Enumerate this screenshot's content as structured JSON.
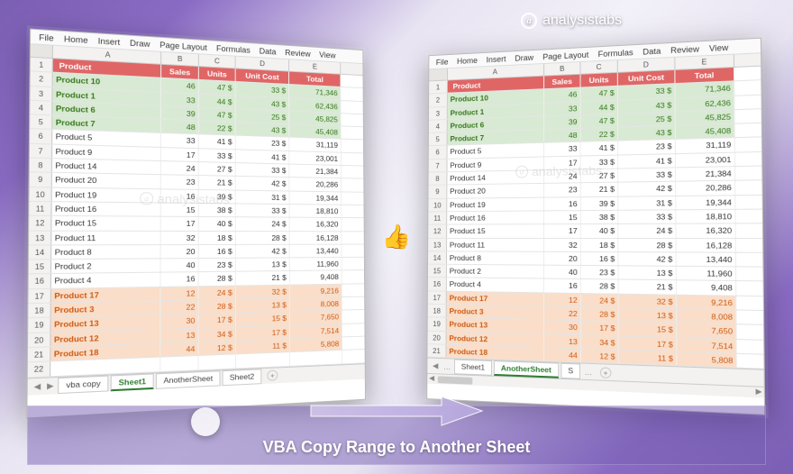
{
  "brand": "analysistabs",
  "banner_title": "VBA Copy Range to Another Sheet",
  "ribbon": [
    "File",
    "Home",
    "Insert",
    "Draw",
    "Page Layout",
    "Formulas",
    "Data",
    "Review",
    "View"
  ],
  "columns": [
    "A",
    "B",
    "C",
    "D",
    "E"
  ],
  "header_row": {
    "product": "Product",
    "sales": "Sales",
    "units": "Units",
    "unit_cost": "Unit Cost",
    "total": "Total"
  },
  "left_rows": [
    {
      "n": 1,
      "cls": "hdr-row",
      "a": "Product",
      "b": "Sales",
      "c": "Units",
      "d": "Unit Cost",
      "e": "Total"
    },
    {
      "n": 2,
      "cls": "green",
      "a": "Product 10",
      "b": "46",
      "c": "47 $",
      "d": "33 $",
      "e": "71,346"
    },
    {
      "n": 3,
      "cls": "green",
      "a": "Product 1",
      "b": "33",
      "c": "44 $",
      "d": "43 $",
      "e": "62,436"
    },
    {
      "n": 4,
      "cls": "green",
      "a": "Product 6",
      "b": "39",
      "c": "47 $",
      "d": "25 $",
      "e": "45,825"
    },
    {
      "n": 5,
      "cls": "green",
      "a": "Product 7",
      "b": "48",
      "c": "22 $",
      "d": "43 $",
      "e": "45,408"
    },
    {
      "n": 6,
      "cls": "plain",
      "a": "Product 5",
      "b": "33",
      "c": "41 $",
      "d": "23 $",
      "e": "31,119"
    },
    {
      "n": 7,
      "cls": "plain",
      "a": "Product 9",
      "b": "17",
      "c": "33 $",
      "d": "41 $",
      "e": "23,001"
    },
    {
      "n": 8,
      "cls": "plain",
      "a": "Product 14",
      "b": "24",
      "c": "27 $",
      "d": "33 $",
      "e": "21,384"
    },
    {
      "n": 9,
      "cls": "plain",
      "a": "Product 20",
      "b": "23",
      "c": "21 $",
      "d": "42 $",
      "e": "20,286"
    },
    {
      "n": 10,
      "cls": "plain",
      "a": "Product 19",
      "b": "16",
      "c": "39 $",
      "d": "31 $",
      "e": "19,344"
    },
    {
      "n": 11,
      "cls": "plain",
      "a": "Product 16",
      "b": "15",
      "c": "38 $",
      "d": "33 $",
      "e": "18,810"
    },
    {
      "n": 12,
      "cls": "plain",
      "a": "Product 15",
      "b": "17",
      "c": "40 $",
      "d": "24 $",
      "e": "16,320"
    },
    {
      "n": 13,
      "cls": "plain",
      "a": "Product 11",
      "b": "32",
      "c": "18 $",
      "d": "28 $",
      "e": "16,128"
    },
    {
      "n": 14,
      "cls": "plain",
      "a": "Product 8",
      "b": "20",
      "c": "16 $",
      "d": "42 $",
      "e": "13,440"
    },
    {
      "n": 15,
      "cls": "plain",
      "a": "Product 2",
      "b": "40",
      "c": "23 $",
      "d": "13 $",
      "e": "11,960"
    },
    {
      "n": 16,
      "cls": "plain",
      "a": "Product 4",
      "b": "16",
      "c": "28 $",
      "d": "21 $",
      "e": "9,408"
    },
    {
      "n": 17,
      "cls": "orange",
      "a": "Product 17",
      "b": "12",
      "c": "24 $",
      "d": "32 $",
      "e": "9,216"
    },
    {
      "n": 18,
      "cls": "orange",
      "a": "Product 3",
      "b": "22",
      "c": "28 $",
      "d": "13 $",
      "e": "8,008"
    },
    {
      "n": 19,
      "cls": "orange",
      "a": "Product 13",
      "b": "30",
      "c": "17 $",
      "d": "15 $",
      "e": "7,650"
    },
    {
      "n": 20,
      "cls": "orange",
      "a": "Product 12",
      "b": "13",
      "c": "34 $",
      "d": "17 $",
      "e": "7,514"
    },
    {
      "n": 21,
      "cls": "orange",
      "a": "Product 18",
      "b": "44",
      "c": "12 $",
      "d": "11 $",
      "e": "5,808"
    },
    {
      "n": 22,
      "cls": "plain",
      "a": "",
      "b": "",
      "c": "",
      "d": "",
      "e": ""
    }
  ],
  "left_tabs": {
    "items": [
      "vba copy",
      "Sheet1",
      "AnotherSheet",
      "Sheet2"
    ],
    "active": 1
  },
  "right_rows": [
    {
      "n": 1,
      "cls": "hdr-row",
      "a": "Product",
      "b": "Sales",
      "c": "Units",
      "d": "Unit Cost",
      "e": "Total"
    },
    {
      "n": 2,
      "cls": "green",
      "a": "Product 10",
      "b": "46",
      "c": "47 $",
      "d": "33   $",
      "e": "71,346"
    },
    {
      "n": 3,
      "cls": "green",
      "a": "Product 1",
      "b": "33",
      "c": "44 $",
      "d": "43   $",
      "e": "62,436"
    },
    {
      "n": 4,
      "cls": "green",
      "a": "Product 6",
      "b": "39",
      "c": "47 $",
      "d": "25   $",
      "e": "45,825"
    },
    {
      "n": 5,
      "cls": "green",
      "a": "Product 7",
      "b": "48",
      "c": "22 $",
      "d": "43   $",
      "e": "45,408"
    },
    {
      "n": 6,
      "cls": "plain",
      "a": "Product 5",
      "b": "33",
      "c": "41 $",
      "d": "23   $",
      "e": "31,119"
    },
    {
      "n": 7,
      "cls": "plain",
      "a": "Product 9",
      "b": "17",
      "c": "33 $",
      "d": "41   $",
      "e": "23,001"
    },
    {
      "n": 8,
      "cls": "plain",
      "a": "Product 14",
      "b": "24",
      "c": "27 $",
      "d": "33   $",
      "e": "21,384"
    },
    {
      "n": 9,
      "cls": "plain",
      "a": "Product 20",
      "b": "23",
      "c": "21 $",
      "d": "42   $",
      "e": "20,286"
    },
    {
      "n": 10,
      "cls": "plain",
      "a": "Product 19",
      "b": "16",
      "c": "39 $",
      "d": "31   $",
      "e": "19,344"
    },
    {
      "n": 11,
      "cls": "plain",
      "a": "Product 16",
      "b": "15",
      "c": "38 $",
      "d": "33   $",
      "e": "18,810"
    },
    {
      "n": 12,
      "cls": "plain",
      "a": "Product 15",
      "b": "17",
      "c": "40 $",
      "d": "24   $",
      "e": "16,320"
    },
    {
      "n": 13,
      "cls": "plain",
      "a": "Product 11",
      "b": "32",
      "c": "18 $",
      "d": "28   $",
      "e": "16,128"
    },
    {
      "n": 14,
      "cls": "plain",
      "a": "Product 8",
      "b": "20",
      "c": "16 $",
      "d": "42   $",
      "e": "13,440"
    },
    {
      "n": 15,
      "cls": "plain",
      "a": "Product 2",
      "b": "40",
      "c": "23 $",
      "d": "13   $",
      "e": "11,960"
    },
    {
      "n": 16,
      "cls": "plain",
      "a": "Product 4",
      "b": "16",
      "c": "28 $",
      "d": "21   $",
      "e": "9,408"
    },
    {
      "n": 17,
      "cls": "orange",
      "a": "Product 17",
      "b": "12",
      "c": "24 $",
      "d": "32   $",
      "e": "9,216"
    },
    {
      "n": 18,
      "cls": "orange",
      "a": "Product 3",
      "b": "22",
      "c": "28 $",
      "d": "13   $",
      "e": "8,008"
    },
    {
      "n": 19,
      "cls": "orange",
      "a": "Product 13",
      "b": "30",
      "c": "17 $",
      "d": "15   $",
      "e": "7,650"
    },
    {
      "n": 20,
      "cls": "orange",
      "a": "Product 12",
      "b": "13",
      "c": "34 $",
      "d": "17   $",
      "e": "7,514"
    },
    {
      "n": 21,
      "cls": "orange",
      "a": "Product 18",
      "b": "44",
      "c": "12 $",
      "d": "11   $",
      "e": "5,808"
    }
  ],
  "right_tabs": {
    "items": [
      "Sheet1",
      "AnotherSheet",
      "S"
    ],
    "active": 1
  }
}
